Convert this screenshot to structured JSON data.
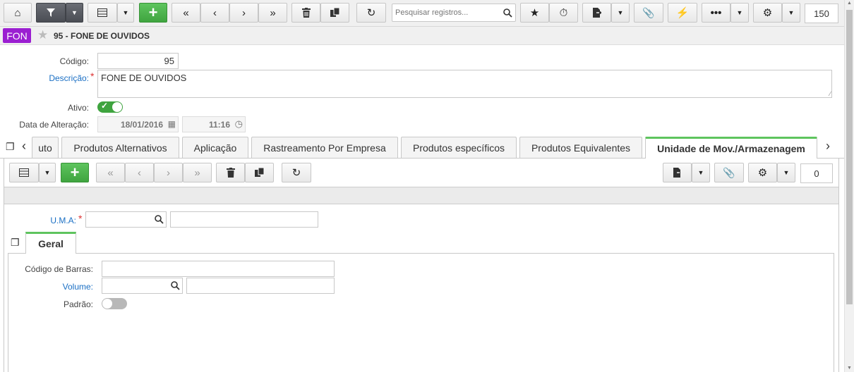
{
  "toolbar": {
    "search_placeholder": "Pesquisar registros...",
    "record_count": "150"
  },
  "header": {
    "badge": "FON",
    "title": "95 - FONE DE OUVIDOS"
  },
  "form": {
    "codigo_label": "Código:",
    "codigo_value": "95",
    "descricao_label": "Descrição:",
    "descricao_value": "FONE DE OUVIDOS",
    "ativo_label": "Ativo:",
    "data_label": "Data de Alteração:",
    "data_date": "18/01/2016",
    "data_time": "11:16"
  },
  "tabs": [
    {
      "label": "uto"
    },
    {
      "label": "Produtos Alternativos"
    },
    {
      "label": "Aplicação"
    },
    {
      "label": "Rastreamento Por Empresa"
    },
    {
      "label": "Produtos específicos"
    },
    {
      "label": "Produtos Equivalentes"
    },
    {
      "label": "Unidade de Mov./Armazenagem",
      "active": true
    }
  ],
  "subtoolbar": {
    "record_count": "0"
  },
  "subform": {
    "uma_label": "U.M.A:",
    "geral_tab": "Geral",
    "barras_label": "Código de Barras:",
    "volume_label": "Volume:",
    "padrao_label": "Padrão:"
  },
  "colors": {
    "accent_green": "#5ec45e",
    "badge_purple": "#9b1fd1",
    "link_blue": "#1a6fc4"
  }
}
